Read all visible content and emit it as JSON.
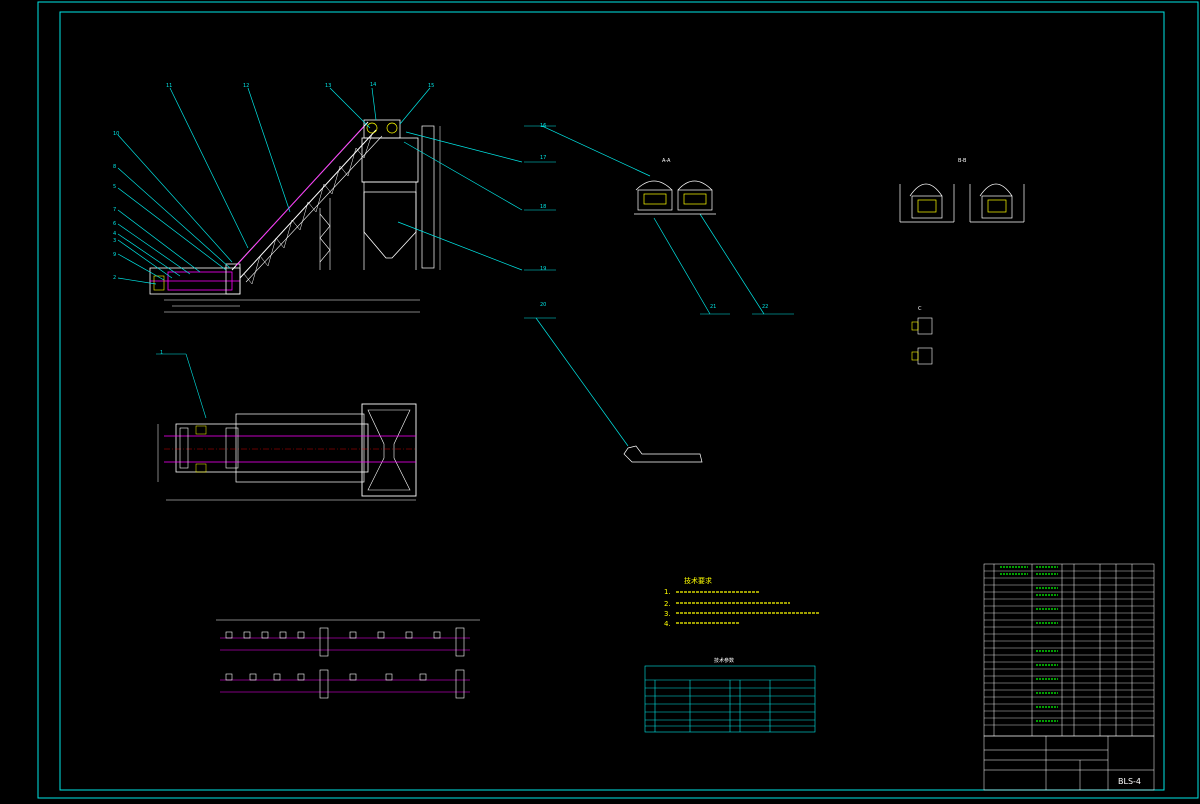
{
  "drawing": {
    "drawing_number": "BLS-4",
    "part_callouts": [
      "1",
      "2",
      "3",
      "4",
      "5",
      "6",
      "7",
      "8",
      "9",
      "10",
      "11",
      "12",
      "13",
      "14",
      "15",
      "16",
      "17",
      "18",
      "19",
      "20",
      "21",
      "22",
      "23",
      "24"
    ],
    "section_labels": {
      "a": "A-A",
      "b": "B-B",
      "c": "C"
    },
    "tech_notes_title": "技术要求",
    "tech_notes": [
      "1.",
      "2.",
      "3.",
      "4."
    ],
    "params_table_title": "技术参数",
    "colors": {
      "frame": "#00e6e6",
      "structure": "#ffffff",
      "belt": "#ff00ff",
      "notes": "#ffff00",
      "background": "#000000"
    }
  }
}
